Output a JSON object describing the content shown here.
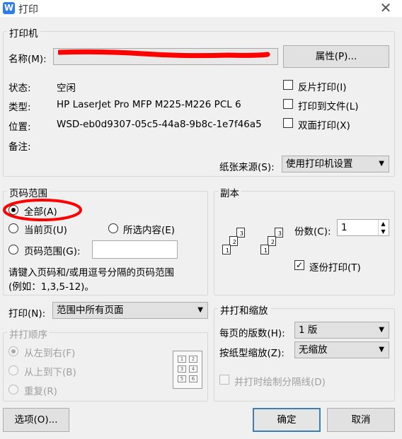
{
  "window": {
    "title": "打印",
    "app_icon_letter": "W"
  },
  "printer": {
    "group_title": "打印机",
    "name_label": "名称(M):",
    "properties_button": "属性(P)...",
    "status_label": "状态:",
    "status_value": "空闲",
    "type_label": "类型:",
    "type_value": "HP LaserJet Pro MFP M225-M226 PCL 6",
    "location_label": "位置:",
    "location_value": "WSD-eb0d9307-05c5-44a8-9b8c-1e7f46a5",
    "comment_label": "备注:",
    "reverse_print": "反片打印(I)",
    "print_to_file": "打印到文件(L)",
    "duplex": "双面打印(X)",
    "paper_source_label": "纸张来源(S):",
    "paper_source_value": "使用打印机设置"
  },
  "page_range": {
    "group_title": "页码范围",
    "all": "全部(A)",
    "current": "当前页(U)",
    "selection": "所选内容(E)",
    "pages": "页码范围(G):",
    "hint_line1": "请键入页码和/或用逗号分隔的页码范围",
    "hint_line2": "(例如：1,3,5-12)。"
  },
  "copies": {
    "group_title": "副本",
    "count_label": "份数(C):",
    "count_value": "1",
    "collate": "逐份打印(T)",
    "page_numbers": [
      "1",
      "2",
      "3"
    ]
  },
  "print_what": {
    "label": "打印(N):",
    "value": "范围中所有页面"
  },
  "print_order": {
    "group_title": "并打顺序",
    "left_to_right": "从左到右(F)",
    "top_to_bottom": "从上到下(B)",
    "repeat": "重复(R)",
    "grid_numbers": [
      "1",
      "2",
      "3",
      "4",
      "5",
      "6"
    ]
  },
  "zoom": {
    "group_title": "并打和缩放",
    "pages_per_sheet_label": "每页的版数(H):",
    "pages_per_sheet_value": "1 版",
    "scale_label": "按纸型缩放(Z):",
    "scale_value": "无缩放",
    "draw_lines": "并打时绘制分隔线(D)"
  },
  "buttons": {
    "options": "选项(O)...",
    "ok": "确定",
    "cancel": "取消"
  },
  "colors": {
    "annotation_red": "#ff0000",
    "default_button_border": "#3c7fb1",
    "icon_blue": "#2b7de9"
  }
}
